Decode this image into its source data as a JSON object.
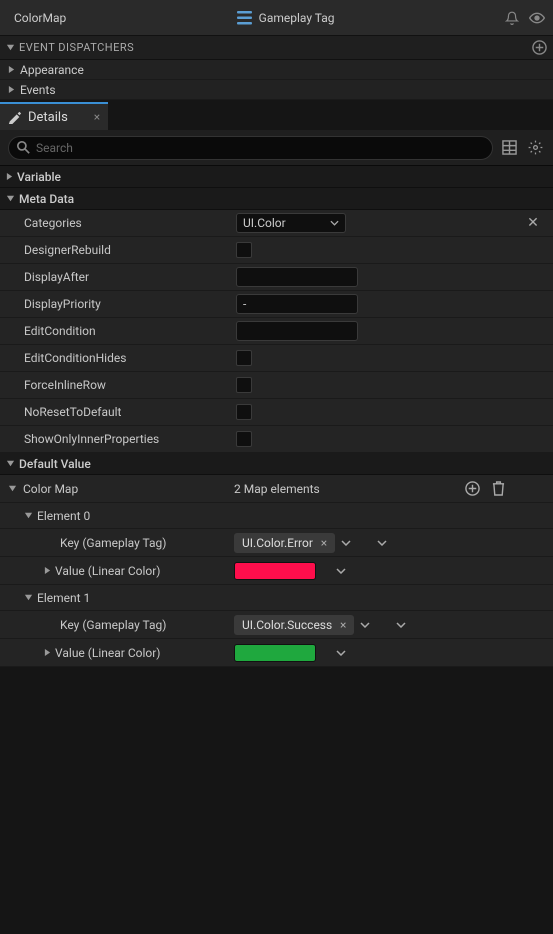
{
  "topBar": {
    "title": "ColorMap",
    "centerLabel": "Gameplay Tag"
  },
  "eventDispatchers": {
    "header": "EVENT DISPATCHERS",
    "items": [
      "Appearance",
      "Events"
    ]
  },
  "detailsTab": {
    "label": "Details"
  },
  "search": {
    "placeholder": "Search"
  },
  "variableSection": {
    "label": "Variable"
  },
  "metaData": {
    "label": "Meta Data",
    "categories": {
      "label": "Categories",
      "value": "UI.Color"
    },
    "designerRebuild": {
      "label": "DesignerRebuild"
    },
    "displayAfter": {
      "label": "DisplayAfter",
      "value": ""
    },
    "displayPriority": {
      "label": "DisplayPriority",
      "value": "-"
    },
    "editCondition": {
      "label": "EditCondition",
      "value": ""
    },
    "editConditionHides": {
      "label": "EditConditionHides"
    },
    "forceInlineRow": {
      "label": "ForceInlineRow"
    },
    "noResetToDefault": {
      "label": "NoResetToDefault"
    },
    "showOnlyInnerProperties": {
      "label": "ShowOnlyInnerProperties"
    }
  },
  "defaultValue": {
    "label": "Default Value",
    "colorMap": {
      "label": "Color Map",
      "count": "2 Map elements",
      "elements": [
        {
          "header": "Element 0",
          "keyLabel": "Key (Gameplay Tag)",
          "keyTag": "UI.Color.Error",
          "valueLabel": "Value (Linear Color)",
          "color": "#ff0e4c"
        },
        {
          "header": "Element 1",
          "keyLabel": "Key (Gameplay Tag)",
          "keyTag": "UI.Color.Success",
          "valueLabel": "Value (Linear Color)",
          "color": "#1fa83e"
        }
      ]
    }
  }
}
